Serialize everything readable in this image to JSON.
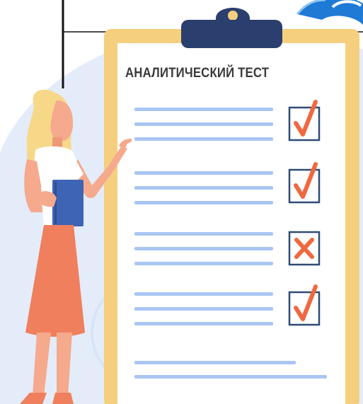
{
  "clipboard": {
    "title": "АНАЛИТИЧЕСКИЙ ТЕСТ",
    "items": [
      {
        "status": "check"
      },
      {
        "status": "check"
      },
      {
        "status": "cross"
      },
      {
        "status": "check"
      }
    ]
  },
  "colors": {
    "background_blob": "#e4ecfa",
    "board": "#f6cf7e",
    "paper": "#ffffff",
    "clip": "#2a3f6e",
    "text_line": "#a9c6f2",
    "mark": "#f0683f",
    "checkbox_border": "#2f4b74",
    "skirt": "#f07f5d",
    "hair": "#f7d889",
    "folder": "#3e64b5"
  },
  "icons": [
    "clipboard-clip-icon",
    "check-icon",
    "cross-icon",
    "logo-icon"
  ]
}
